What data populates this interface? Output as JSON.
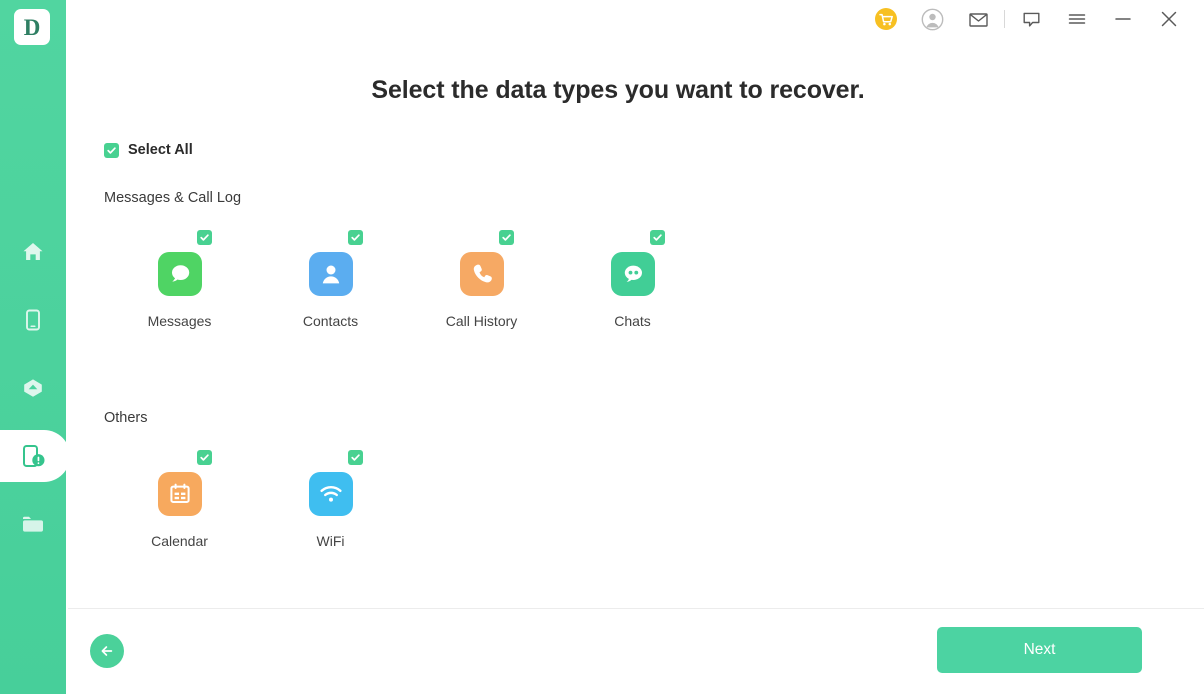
{
  "app": {
    "logo_letter": "D",
    "accent_green": "#4CD3A2",
    "title": "Select the data types you want to recover."
  },
  "titlebar": {
    "buttons": [
      {
        "name": "cart-icon",
        "label": "Cart",
        "color": "#F7C022"
      },
      {
        "name": "account-icon",
        "label": "Account",
        "color": "#B4B4B4"
      },
      {
        "name": "mail-icon",
        "label": "Mail",
        "color": "#5A5A5A"
      },
      {
        "name": "feedback-icon",
        "label": "Feedback",
        "color": "#5A5A5A"
      },
      {
        "name": "menu-icon",
        "label": "Menu",
        "color": "#5A5A5A"
      },
      {
        "name": "minimize-icon",
        "label": "Minimize",
        "color": "#5A5A5A"
      },
      {
        "name": "close-icon",
        "label": "Close",
        "color": "#5A5A5A"
      }
    ]
  },
  "sidebar": {
    "items": [
      {
        "name": "sidebar-item-home",
        "label": "Home",
        "active": false
      },
      {
        "name": "sidebar-item-device",
        "label": "Device",
        "active": false
      },
      {
        "name": "sidebar-item-cloud",
        "label": "Cloud",
        "active": false
      },
      {
        "name": "sidebar-item-recovery",
        "label": "Data Recovery",
        "active": true
      },
      {
        "name": "sidebar-item-files",
        "label": "Files",
        "active": false
      }
    ]
  },
  "main": {
    "select_all_label": "Select All",
    "select_all_checked": true,
    "groups": [
      {
        "label": "Messages & Call Log",
        "items": [
          {
            "label": "Messages",
            "icon": "messages-icon",
            "color": "#4FD464",
            "checked": true
          },
          {
            "label": "Contacts",
            "icon": "contacts-icon",
            "color": "#5BADF0",
            "checked": true
          },
          {
            "label": "Call History",
            "icon": "call-history-icon",
            "color": "#F6A964",
            "checked": true
          },
          {
            "label": "Chats",
            "icon": "chats-icon",
            "color": "#41CE96",
            "checked": true
          }
        ]
      },
      {
        "label": "Others",
        "items": [
          {
            "label": "Calendar",
            "icon": "calendar-icon",
            "color": "#F7A95E",
            "checked": true
          },
          {
            "label": "WiFi",
            "icon": "wifi-icon",
            "color": "#3FBEF0",
            "checked": true
          }
        ]
      }
    ]
  },
  "footer": {
    "back_label": "Back",
    "next_label": "Next"
  }
}
